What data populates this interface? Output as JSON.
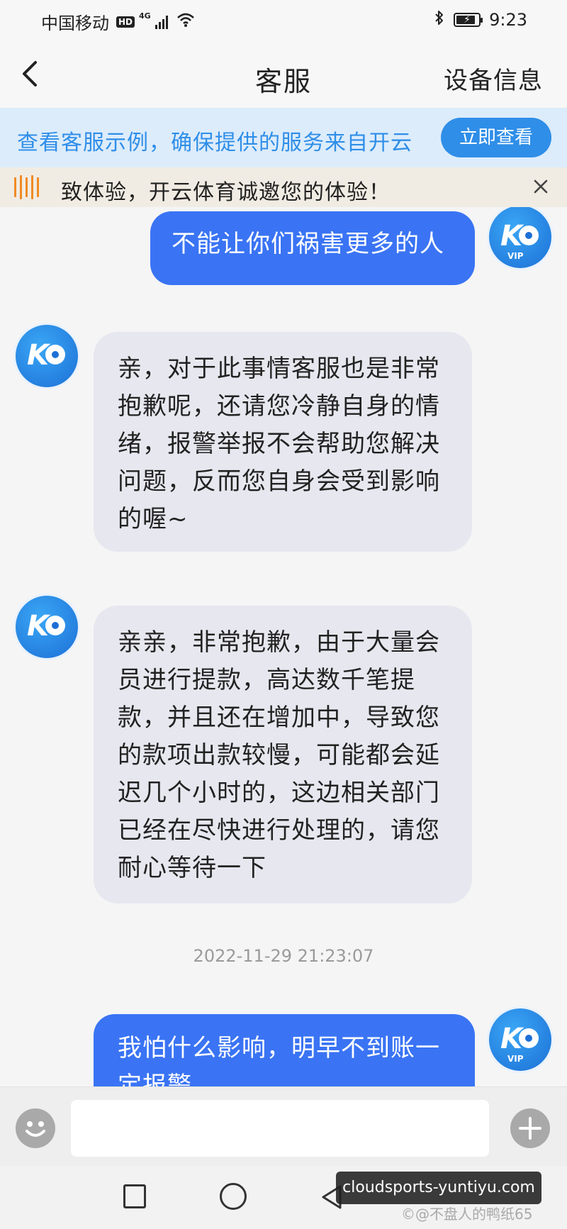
{
  "status_bar": {
    "carrier": "中国移动",
    "hd": "HD",
    "network": "4G",
    "time": "9:23",
    "icons": [
      "signal-icon",
      "wifi-icon",
      "bluetooth-icon",
      "battery-icon"
    ]
  },
  "header": {
    "title": "客服",
    "device_info_label": "设备信息",
    "back_icon": "chevron-left-icon"
  },
  "info_banner": {
    "text": "查看客服示例，确保提供的服务来自开云",
    "button_label": "立即查看"
  },
  "notice": {
    "text": "致体验，开云体育诚邀您的体验！",
    "close_icon": "close-icon"
  },
  "chat": {
    "messages": [
      {
        "sender": "user",
        "text": "不能让你们祸害更多的人"
      },
      {
        "sender": "agent",
        "text": "亲，对于此事情客服也是非常抱歉呢，还请您冷静自身的情绪，报警举报不会帮助您解决问题，反而您自身会受到影响的喔~"
      },
      {
        "sender": "agent",
        "text": "亲亲，非常抱歉，由于大量会员进行提款，高达数千笔提款，并且还在增加中，导致您的款项出款较慢，可能都会延迟几个小时的，这边相关部门已经在尽快进行处理的，请您耐心等待一下"
      },
      {
        "sender": "user",
        "text": "我怕什么影响，明早不到账一定报警"
      }
    ],
    "timestamp": "2022-11-29 21:23:07",
    "avatar_label": "VIP"
  },
  "input_bar": {
    "placeholder": "",
    "emoji_icon": "emoji-icon",
    "plus_icon": "plus-icon"
  },
  "overlay": {
    "promo_text": "cloudsports-yuntiyu.com",
    "watermark": "©@不盘人的鸭纸65"
  },
  "colors": {
    "accent_blue": "#3a74f4",
    "banner_blue": "#2f8ee8",
    "agent_bubble": "#e7e7ef",
    "notice_orange": "#f08a24"
  }
}
